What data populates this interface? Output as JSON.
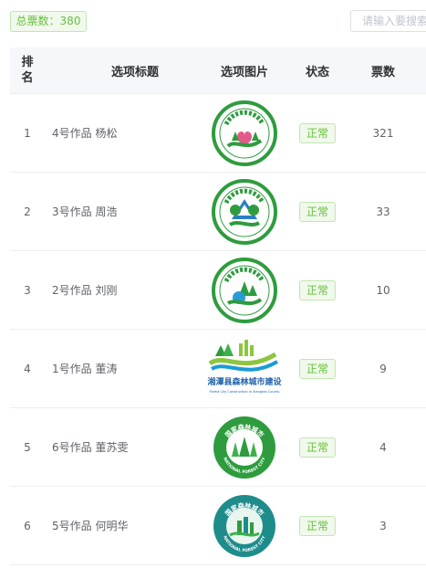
{
  "header": {
    "total_votes_label": "总票数：380",
    "search_placeholder": "请输入要搜索"
  },
  "table": {
    "columns": {
      "rank": "排名",
      "rank_line1": "排",
      "rank_line2": "名",
      "title": "选项标题",
      "image": "选项图片",
      "status": "状态",
      "votes": "票数"
    },
    "rows": [
      {
        "rank": "1",
        "title": "4号作品 杨松",
        "status": "正常",
        "votes": "321",
        "logo": "forest-city-logo-heart"
      },
      {
        "rank": "2",
        "title": "3号作品 周浩",
        "status": "正常",
        "votes": "33",
        "logo": "forest-city-logo-tree"
      },
      {
        "rank": "3",
        "title": "2号作品 刘刚",
        "status": "正常",
        "votes": "10",
        "logo": "forest-city-logo-wave"
      },
      {
        "rank": "4",
        "title": "1号作品 董涛",
        "status": "正常",
        "votes": "9",
        "logo": "forest-city-logo-banner",
        "logo_text": "湘潭县森林城市建设",
        "logo_subtext": "Forest City Construction in Xiangtan County"
      },
      {
        "rank": "5",
        "title": "6号作品 董苏雯",
        "status": "正常",
        "votes": "4",
        "logo": "forest-city-logo-green",
        "logo_text": "国家森林城市",
        "logo_subtext": "NATIONAL FOREST CITY"
      },
      {
        "rank": "6",
        "title": "5号作品 何明华",
        "status": "正常",
        "votes": "3",
        "logo": "forest-city-logo-teal",
        "logo_text": "国家森林城市",
        "logo_subtext": "NATIONAL FOREST CITY"
      }
    ]
  },
  "colors": {
    "success": "#67c23a",
    "success_bg": "#f0f9eb",
    "header_bg": "#f5f7fa",
    "logo_green": "#2e9c3e",
    "logo_teal": "#1f8c8c"
  }
}
